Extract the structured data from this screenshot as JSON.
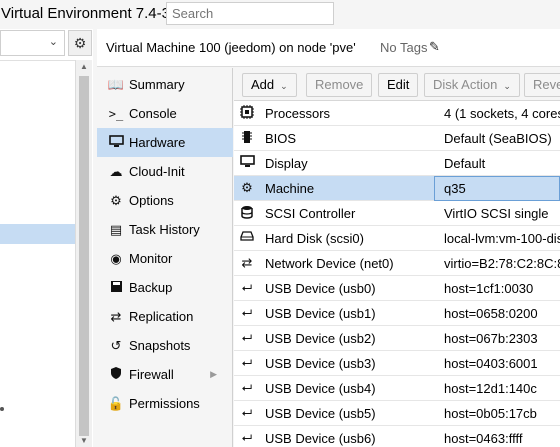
{
  "app": {
    "title": "Virtual Environment 7.4-3",
    "search_placeholder": "Search"
  },
  "header": {
    "vm_title": "Virtual Machine 100 (jeedom) on node 'pve'",
    "tags_label": "No Tags"
  },
  "nav": {
    "items": [
      {
        "label": "Summary",
        "icon": "book-icon"
      },
      {
        "label": "Console",
        "icon": "terminal-icon"
      },
      {
        "label": "Hardware",
        "icon": "monitor-icon"
      },
      {
        "label": "Cloud-Init",
        "icon": "cloud-icon"
      },
      {
        "label": "Options",
        "icon": "gear-icon"
      },
      {
        "label": "Task History",
        "icon": "list-icon"
      },
      {
        "label": "Monitor",
        "icon": "eye-icon"
      },
      {
        "label": "Backup",
        "icon": "floppy-icon"
      },
      {
        "label": "Replication",
        "icon": "retweet-icon"
      },
      {
        "label": "Snapshots",
        "icon": "history-icon"
      },
      {
        "label": "Firewall",
        "icon": "shield-icon"
      },
      {
        "label": "Permissions",
        "icon": "unlock-icon"
      }
    ],
    "active": "Hardware"
  },
  "toolbar": {
    "add_label": "Add",
    "remove_label": "Remove",
    "edit_label": "Edit",
    "disk_action_label": "Disk Action",
    "revert_label": "Reve"
  },
  "hardware": {
    "rows": [
      {
        "name": "Processors",
        "value": "4 (1 sockets, 4 cores",
        "icon": "cpu-icon"
      },
      {
        "name": "BIOS",
        "value": "Default (SeaBIOS)",
        "icon": "microchip-icon"
      },
      {
        "name": "Display",
        "value": "Default",
        "icon": "desktop-icon"
      },
      {
        "name": "Machine",
        "value": "q35",
        "icon": "cogs-icon"
      },
      {
        "name": "SCSI Controller",
        "value": "VirtIO SCSI single",
        "icon": "database-icon"
      },
      {
        "name": "Hard Disk (scsi0)",
        "value": "local-lvm:vm-100-dis",
        "icon": "hdd-icon"
      },
      {
        "name": "Network Device (net0)",
        "value": "virtio=B2:78:C2:8C:8",
        "icon": "exchange-icon"
      },
      {
        "name": "USB Device (usb0)",
        "value": "host=1cf1:0030",
        "icon": "usb-icon"
      },
      {
        "name": "USB Device (usb1)",
        "value": "host=0658:0200",
        "icon": "usb-icon"
      },
      {
        "name": "USB Device (usb2)",
        "value": "host=067b:2303",
        "icon": "usb-icon"
      },
      {
        "name": "USB Device (usb3)",
        "value": "host=0403:6001",
        "icon": "usb-icon"
      },
      {
        "name": "USB Device (usb4)",
        "value": "host=12d1:140c",
        "icon": "usb-icon"
      },
      {
        "name": "USB Device (usb5)",
        "value": "host=0b05:17cb",
        "icon": "usb-icon"
      },
      {
        "name": "USB Device (usb6)",
        "value": "host=0463:ffff",
        "icon": "usb-icon"
      }
    ],
    "selected": "Machine"
  },
  "colors": {
    "selection": "#c6dcf3",
    "selection_border": "#6a9fd6"
  }
}
